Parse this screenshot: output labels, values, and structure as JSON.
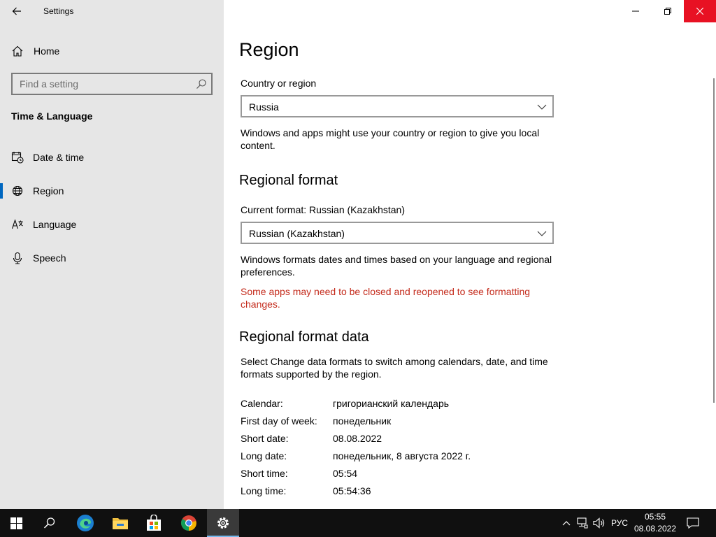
{
  "window": {
    "app_title": "Settings",
    "controls": [
      "minimize",
      "maximize",
      "close"
    ]
  },
  "sidebar": {
    "home_label": "Home",
    "search": {
      "placeholder": "Find a setting",
      "value": ""
    },
    "section_title": "Time & Language",
    "items": [
      {
        "label": "Date & time",
        "icon": "calendar-clock-icon",
        "active": false
      },
      {
        "label": "Region",
        "icon": "globe-icon",
        "active": true
      },
      {
        "label": "Language",
        "icon": "language-icon",
        "active": false
      },
      {
        "label": "Speech",
        "icon": "microphone-icon",
        "active": false
      }
    ]
  },
  "main": {
    "title": "Region",
    "country": {
      "label": "Country or region",
      "value": "Russia",
      "description": "Windows and apps might use your country or region to give you local content."
    },
    "regional_format": {
      "heading": "Regional format",
      "current_label": "Current format: Russian (Kazakhstan)",
      "value": "Russian (Kazakhstan)",
      "description": "Windows formats dates and times based on your language and regional preferences.",
      "warning": "Some apps may need to be closed and reopened to see formatting changes."
    },
    "format_data": {
      "heading": "Regional format data",
      "description": "Select Change data formats to switch among calendars, date, and time formats supported by the region.",
      "rows": [
        {
          "key": "Calendar:",
          "value": "григорианский календарь"
        },
        {
          "key": "First day of week:",
          "value": "понедельник"
        },
        {
          "key": "Short date:",
          "value": "08.08.2022"
        },
        {
          "key": "Long date:",
          "value": "понедельник, 8 августа 2022 г."
        },
        {
          "key": "Short time:",
          "value": "05:54"
        },
        {
          "key": "Long time:",
          "value": "05:54:36"
        }
      ]
    }
  },
  "taskbar": {
    "apps": [
      "start-icon",
      "search-icon",
      "edge-icon",
      "file-explorer-icon",
      "store-icon",
      "chrome-icon",
      "settings-icon"
    ],
    "language": "РУС",
    "time": "05:55",
    "date": "08.08.2022"
  },
  "colors": {
    "accent": "#0067c0",
    "close": "#e81123",
    "warning": "#c42b1c",
    "sidebar_bg": "#e6e6e6",
    "taskbar_bg": "#101010"
  }
}
